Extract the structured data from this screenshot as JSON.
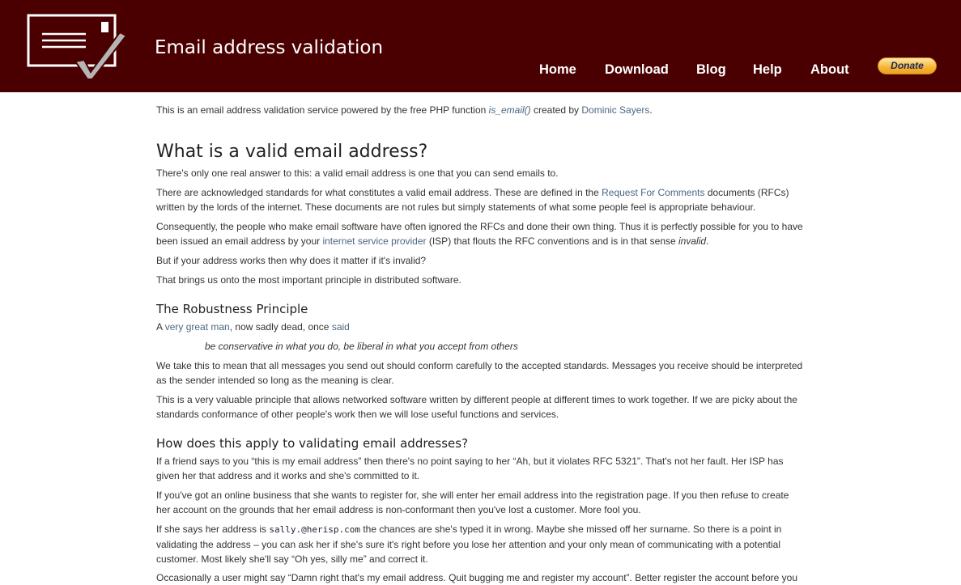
{
  "header": {
    "title": "Email address validation",
    "logo_icon": "envelope-checkmark-icon",
    "background": "#4a0000"
  },
  "nav": {
    "home": "Home",
    "download": "Download",
    "blog": "Blog",
    "help": "Help",
    "about": "About",
    "donate": "Donate"
  },
  "intro": {
    "t1": "This is an email address validation service powered by the free PHP function ",
    "fn": "is_email()",
    "t2": " created by ",
    "author": "Dominic Sayers",
    "t3": "."
  },
  "s1": {
    "heading": "What is a valid email address?",
    "p1": "There's only one real answer to this: a valid email address is one that you can send emails to.",
    "p2a": "There are acknowledged standards for what constitutes a valid email address. These are defined in the ",
    "p2link": "Request For Comments",
    "p2b": " documents (RFCs) written by the lords of the internet. These documents are not rules but simply statements of what some people feel is appropriate behaviour.",
    "p3a": "Consequently, the people who make email software have often ignored the RFCs and done their own thing. Thus it is perfectly possible for you to have been issued an email address by your ",
    "p3link": "internet service provider",
    "p3b": " (ISP) that flouts the RFC conventions and is in that sense ",
    "p3em": "invalid",
    "p3c": ".",
    "p4": "But if your address works then why does it matter if it's invalid?",
    "p5": "That brings us onto the most important principle in distributed software."
  },
  "s2": {
    "heading": "The Robustness Principle",
    "p1a": "A ",
    "p1link1": "very great man",
    "p1b": ", now sadly dead, once ",
    "p1link2": "said",
    "quote": "be conservative in what you do, be liberal in what you accept from others",
    "p2": "We take this to mean that all messages you send out should conform carefully to the accepted standards. Messages you receive should be interpreted as the sender intended so long as the meaning is clear.",
    "p3": "This is a very valuable principle that allows networked software written by different people at different times to work together. If we are picky about the standards conformance of other people's work then we will lose useful functions and services."
  },
  "s3": {
    "heading": "How does this apply to validating email addresses?",
    "p1": "If a friend says to you “this is my email address” then there's no point saying to her “Ah, but it violates RFC 5321”. That's not her fault. Her ISP has given her that address and it works and she's committed to it.",
    "p2": "If you've got an online business that she wants to register for, she will enter her email address into the registration page. If you then refuse to create her account on the grounds that her email address is non-conformant then you've lost a customer. More fool you.",
    "p3a": "If she says her address is ",
    "p3code": "sally.@herisp.com",
    "p3b": " the chances are she's typed it in wrong. Maybe she missed off her surname. So there is a point in validating the address – you can ask her if she's sure it's right before you lose her attention and your only mean of communicating with a potential customer. Most likely she'll say “Oh yes, silly me” and correct it.",
    "p4": "Occasionally a user might say “Damn right that's my email address. Quit bugging me and register my account”. Better register the account before you"
  }
}
